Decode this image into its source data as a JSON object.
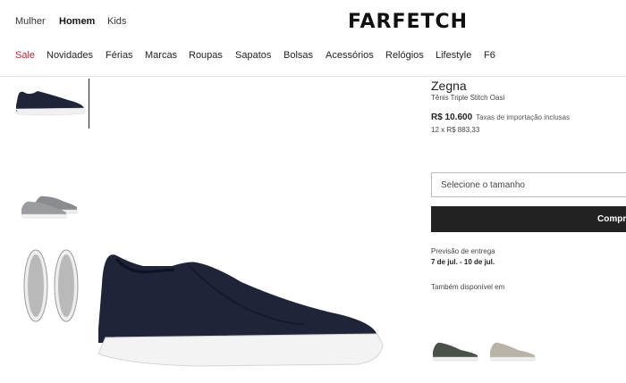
{
  "header": {
    "genders": [
      "Mulher",
      "Homem",
      "Kids"
    ],
    "active_gender": "Homem",
    "logo": "FARFETCH"
  },
  "nav": {
    "items": [
      "Sale",
      "Novidades",
      "Férias",
      "Marcas",
      "Roupas",
      "Sapatos",
      "Bolsas",
      "Acessórios",
      "Relógios",
      "Lifestyle",
      "F6"
    ]
  },
  "colors": {
    "sale": "#c1272d",
    "button": "#222222",
    "shoe_main": "#1f2438",
    "sole": "#f2f2f2"
  },
  "product": {
    "brand": "Zegna",
    "name": "Tênis Triple Stitch Oasi",
    "price": "R$ 10.600",
    "tax_note": "Taxas de importação inclusas",
    "installments": "12 x R$ 883,33",
    "size_placeholder": "Selecione o tamanho",
    "buy_label": "Compr",
    "delivery_label": "Previsão de entrega",
    "delivery_dates": "7 de jul. - 10 de jul.",
    "also_available": "Também disponível em"
  },
  "gallery": {
    "thumbnails": [
      "shoe-side-navy",
      "shoe-pair-grey",
      "shoe-soles-grey"
    ],
    "variants": [
      "shoe-green",
      "shoe-beige"
    ]
  }
}
